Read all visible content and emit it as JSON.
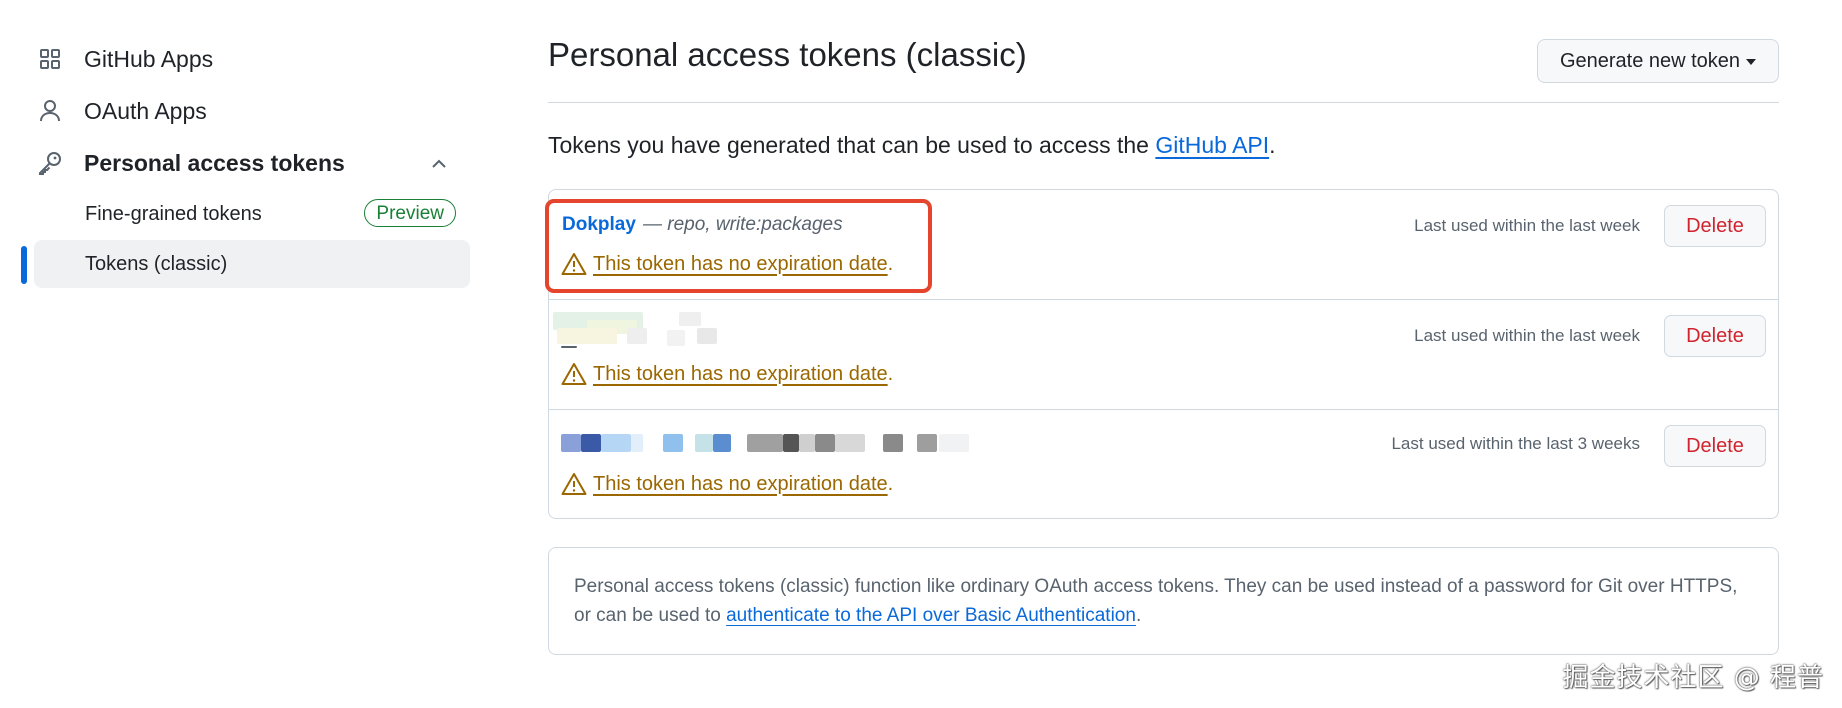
{
  "sidebar": {
    "github_apps": {
      "label": "GitHub Apps",
      "icon": "apps-grid-icon"
    },
    "oauth_apps": {
      "label": "OAuth Apps",
      "icon": "person-icon"
    },
    "personal_access_tokens": {
      "label": "Personal access tokens",
      "icon": "key-icon",
      "expanded": true
    },
    "sub_items": [
      {
        "label": "Fine-grained tokens",
        "badge": "Preview"
      },
      {
        "label": "Tokens (classic)",
        "active": true
      }
    ]
  },
  "main": {
    "title": "Personal access tokens (classic)",
    "generate_button": "Generate new token",
    "intro_text": "Tokens you have generated that can be used to access the ",
    "intro_link": "GitHub API",
    "intro_end": ".",
    "tokens": [
      {
        "name": "Dokplay",
        "scopes": "— repo, write:packages",
        "last_used": "Last used within the last week",
        "warning": "This token has no expiration date",
        "delete": "Delete"
      },
      {
        "name": "",
        "scopes": "",
        "last_used": "Last used within the last week",
        "warning": "This token has no expiration date",
        "delete": "Delete"
      },
      {
        "name": "",
        "scopes": "",
        "last_used": "Last used within the last 3 weeks",
        "warning": "This token has no expiration date",
        "delete": "Delete"
      }
    ],
    "info_text": "Personal access tokens (classic) function like ordinary OAuth access tokens. They can be used instead of a password for Git over HTTPS, or can be used to ",
    "info_link": "authenticate to the API over Basic Authentication",
    "info_end": "."
  },
  "watermark": "掘金技术社区 @ 程普",
  "colors": {
    "accent": "#0969da",
    "warning": "#9a6700",
    "danger": "#d1242f",
    "success": "#1a7f37",
    "highlight_border": "#e5452d"
  }
}
